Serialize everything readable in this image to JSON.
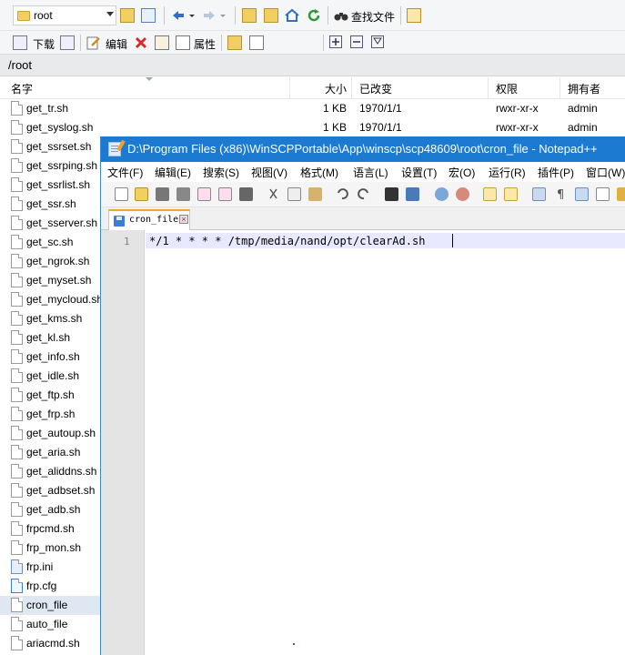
{
  "winscp": {
    "location_combo": "root",
    "toolbar2": {
      "download_label": "下载",
      "edit_label": "编辑",
      "properties_label": "属性"
    },
    "find_files_label": "查找文件",
    "current_path": "/root",
    "columns": {
      "name": "名字",
      "size": "大小",
      "modified": "已改变",
      "permissions": "权限",
      "owner": "拥有者"
    },
    "files": [
      {
        "name": "get_tr.sh",
        "size": "1 KB",
        "modified": "1970/1/1",
        "permissions": "rwxr-xr-x",
        "owner": "admin"
      },
      {
        "name": "get_syslog.sh",
        "size": "1 KB",
        "modified": "1970/1/1",
        "permissions": "rwxr-xr-x",
        "owner": "admin"
      },
      {
        "name": "get_ssrset.sh"
      },
      {
        "name": "get_ssrping.sh"
      },
      {
        "name": "get_ssrlist.sh"
      },
      {
        "name": "get_ssr.sh"
      },
      {
        "name": "get_sserver.sh"
      },
      {
        "name": "get_sc.sh"
      },
      {
        "name": "get_ngrok.sh"
      },
      {
        "name": "get_myset.sh"
      },
      {
        "name": "get_mycloud.sh"
      },
      {
        "name": "get_kms.sh"
      },
      {
        "name": "get_kl.sh"
      },
      {
        "name": "get_info.sh"
      },
      {
        "name": "get_idle.sh"
      },
      {
        "name": "get_ftp.sh"
      },
      {
        "name": "get_frp.sh"
      },
      {
        "name": "get_autoup.sh"
      },
      {
        "name": "get_aria.sh"
      },
      {
        "name": "get_aliddns.sh"
      },
      {
        "name": "get_adbset.sh"
      },
      {
        "name": "get_adb.sh"
      },
      {
        "name": "frpcmd.sh"
      },
      {
        "name": "frp_mon.sh"
      },
      {
        "name": "frp.ini"
      },
      {
        "name": "frp.cfg"
      },
      {
        "name": "cron_file"
      },
      {
        "name": "auto_file"
      },
      {
        "name": "ariacmd.sh"
      }
    ]
  },
  "notepad": {
    "title": "D:\\Program Files (x86)\\WinSCPPortable\\App\\winscp\\scp48609\\root\\cron_file - Notepad++",
    "menu": [
      "文件(F)",
      "编辑(E)",
      "搜索(S)",
      "视图(V)",
      "格式(M)",
      "语言(L)",
      "设置(T)",
      "宏(O)",
      "运行(R)",
      "插件(P)",
      "窗口(W)"
    ],
    "tab_name": "cron_file",
    "line_number": "1",
    "code_line": "*/1 * * * * /tmp/media/nand/opt/clearAd.sh"
  },
  "colors": {
    "title_bar": "#1c7ad1",
    "selection": "#dfe7f3",
    "current_line": "#e8e8ff",
    "tab_accent": "#f5a623"
  }
}
